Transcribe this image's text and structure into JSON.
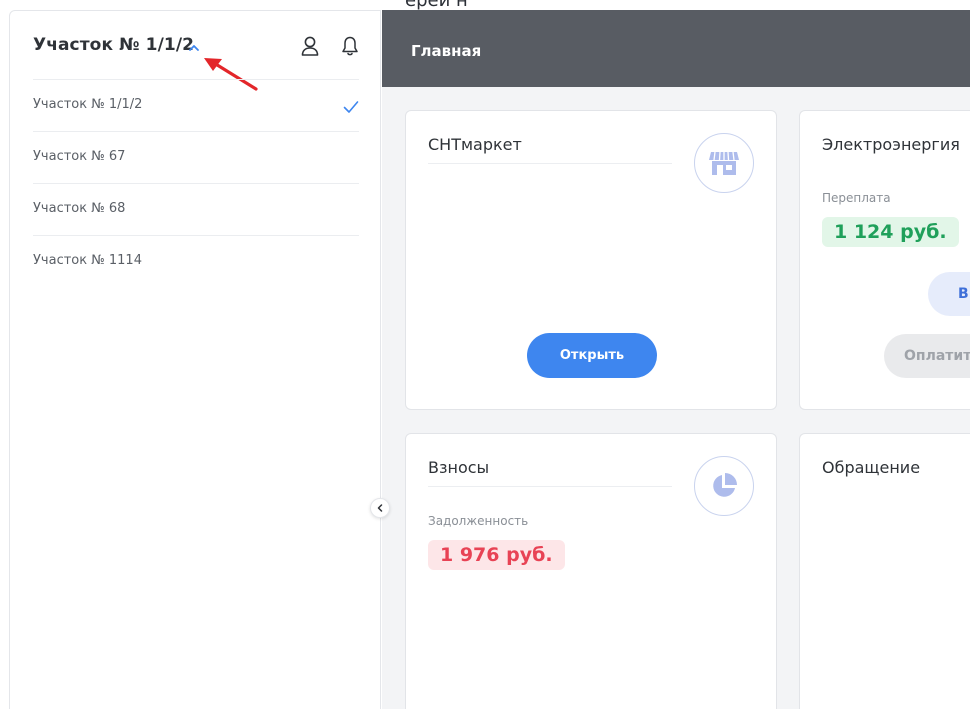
{
  "top_fragment": "ерей н",
  "sidebar": {
    "current_plot": "Участок № 1/1/2",
    "plots": [
      {
        "label": "Участок № 1/1/2",
        "selected": true
      },
      {
        "label": "Участок № 67",
        "selected": false
      },
      {
        "label": "Участок № 68",
        "selected": false
      },
      {
        "label": "Участок № 1114",
        "selected": false
      }
    ]
  },
  "header": {
    "title": "Главная"
  },
  "cards": {
    "market": {
      "title": "СНТмаркет",
      "button": "Открыть"
    },
    "electricity": {
      "title": "Электроэнергия",
      "label": "Переплата",
      "amount": "1 124 руб.",
      "button_light": "В",
      "button_gray": "Оплатить"
    },
    "fees": {
      "title": "Взносы",
      "label": "Задолженность",
      "amount": "1 976 руб."
    },
    "appeal": {
      "title": "Обращение"
    }
  },
  "colors": {
    "accent": "#3e86ef",
    "topbar": "#585c63",
    "positive": "#1fa05a",
    "negative": "#e84355",
    "annotation_arrow": "#e3262a"
  }
}
